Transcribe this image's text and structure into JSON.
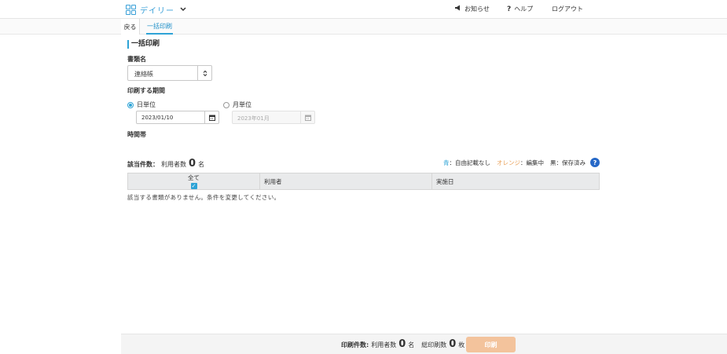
{
  "header": {
    "brand": "デイリー",
    "nav": {
      "notice": "お知らせ",
      "help": "ヘルプ",
      "logout": "ログアウト"
    }
  },
  "subnav": {
    "back": "戻る",
    "active_tab": "一括印刷"
  },
  "page": {
    "title": "一括印刷",
    "doc_label": "書類名",
    "doc_value": "連絡帳",
    "period_label": "印刷する期間",
    "daily_label": "日単位",
    "monthly_label": "月単位",
    "daily_date": "2023/01/10",
    "monthly_date": "2023年01月",
    "timezone_label": "時間帯"
  },
  "summary": {
    "label": "該当件数：",
    "users_label": "利用者数",
    "users_count": "0",
    "users_unit": "名"
  },
  "legend": {
    "blue": "青",
    "blue_desc": "：自由記載なし",
    "orange": "オレンジ",
    "orange_desc": "：編集中",
    "black": "黒",
    "black_desc": "：保存済み",
    "help_icon": "?"
  },
  "table": {
    "col_all": "全て",
    "col_user": "利用者",
    "col_date": "実施日",
    "empty": "該当する書類がありません。条件を変更してください。"
  },
  "footer": {
    "label": "印刷件数:",
    "users_label": "利用者数",
    "users_count": "0",
    "users_unit": "名",
    "sheets_label": "総印刷数",
    "sheets_count": "0",
    "sheets_unit": "枚",
    "print_button": "印刷"
  },
  "colors": {
    "accent": "#2ea3d6",
    "print_button": "#f3c39c",
    "orange_text": "#e9a25b",
    "help_icon": "#2668c7"
  }
}
